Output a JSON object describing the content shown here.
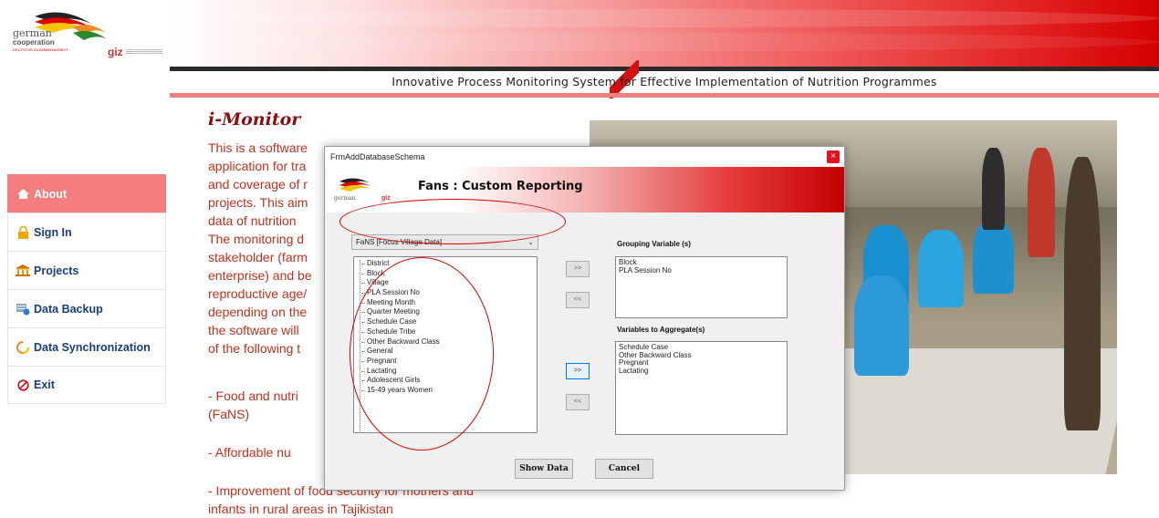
{
  "header": {
    "logo_text_1": "german",
    "logo_text_2": "cooperation",
    "logo_text_3": "DEUTSCHE ZUSAMMENARBEIT",
    "giz_text": "giz",
    "tagline": "Innovative Process Monitoring System for Effective Implementation of Nutrition Programmes"
  },
  "sidebar": {
    "items": [
      {
        "label": "About",
        "icon": "home-icon",
        "active": true
      },
      {
        "label": "Sign In",
        "icon": "lock-icon",
        "active": false
      },
      {
        "label": "Projects",
        "icon": "building-icon",
        "active": false
      },
      {
        "label": "Data Backup",
        "icon": "database-icon",
        "active": false
      },
      {
        "label": "Data Synchronization",
        "icon": "sync-icon",
        "active": false
      },
      {
        "label": "Exit",
        "icon": "exit-icon",
        "active": false
      }
    ]
  },
  "main": {
    "title": "i-Monitor",
    "para_lines": [
      "This is a software",
      "application for tra",
      "and coverage of r",
      "projects. This aim",
      "data of nutrition",
      "The monitoring d",
      "stakeholder (farm",
      "enterprise) and be",
      "reproductive age/",
      "depending on the",
      "the software will",
      "of the following t"
    ],
    "bullet_1_line_1": "- Food and nutri",
    "bullet_1_line_2": "(FaNS)",
    "bullet_2": "- Affordable nu",
    "bullet_3_line_1": "- Improvement of food security for mothers and",
    "bullet_3_line_2": "infants in rural areas in Tajikistan"
  },
  "dialog": {
    "window_title": "FrmAddDatabaseSchema",
    "close_glyph": "×",
    "heading": "Fans : Custom Reporting",
    "combo_value": "FaNS [Focus Village Data]",
    "combo_arrow": "⌄",
    "variables": [
      "District",
      "Block",
      "Village",
      "PLA Session No",
      "Meeting Month",
      "Quarter Meeting",
      "Schedule Case",
      "Schedule Tribe",
      "Other Backward Class",
      "General",
      "Pregnant",
      "Lactating",
      "Adolescent Girls",
      "15-49 years Women"
    ],
    "grouping_label": "Grouping Variable (s)",
    "grouping_items": [
      "Block",
      "PLA Session No"
    ],
    "aggregate_label": "Variables to Aggregate(s)",
    "aggregate_items": [
      "Schedule Case",
      "Other Backward Class",
      "Pregnant",
      "Lactating"
    ],
    "add_group_btn": ">>",
    "remove_group_btn": "<<",
    "add_agg_btn": ">>",
    "remove_agg_btn": "<<",
    "show_data_btn": "Show Data",
    "cancel_btn": "Cancel"
  },
  "colors": {
    "accent_red": "#e21f1f",
    "menu_active": "#f47d7d",
    "menu_text": "#1a3e7a",
    "body_text": "#c0321e",
    "annotation": "#e00000"
  }
}
